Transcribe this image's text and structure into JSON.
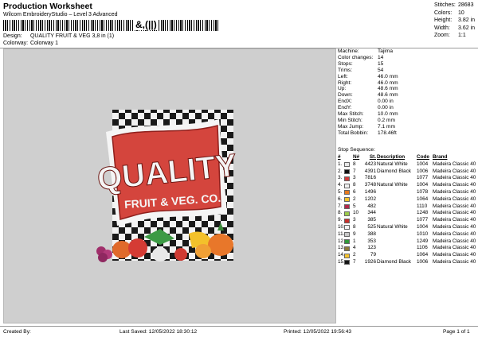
{
  "header": {
    "title": "Production Worksheet",
    "subtitle": "Wilcom EmbroideryStudio – Level 3 Advanced",
    "barcode_text": "&,(||)",
    "design_label": "Design:",
    "design_value": "QUALITY FRUIT & VEG 3,8 in (1)",
    "colorway_label": "Colorway:",
    "colorway_value": "Colorway 1"
  },
  "stats": [
    {
      "key": "Stitches:",
      "value": "28683"
    },
    {
      "key": "Colors:",
      "value": "10"
    },
    {
      "key": "Height:",
      "value": "3.82 in"
    },
    {
      "key": "Width:",
      "value": "3.62 in"
    },
    {
      "key": "Zoom:",
      "value": "1:1"
    }
  ],
  "design_preview": {
    "headline": "QUALITY",
    "tagline": "FRUIT & VEG. CO."
  },
  "info": [
    {
      "key": "Machine:",
      "value": "Tajima"
    },
    {
      "key": "Color changes:",
      "value": "14"
    },
    {
      "key": "Stops:",
      "value": "15"
    },
    {
      "key": "Trims:",
      "value": "54"
    },
    {
      "key": "Left:",
      "value": "46.0 mm"
    },
    {
      "key": "Right:",
      "value": "46.0 mm"
    },
    {
      "key": "Up:",
      "value": "48.6 mm"
    },
    {
      "key": "Down:",
      "value": "48.6 mm"
    },
    {
      "key": "EndX:",
      "value": "0.00 in"
    },
    {
      "key": "EndY:",
      "value": "0.00 in"
    },
    {
      "key": "Max Stitch:",
      "value": "10.0 mm"
    },
    {
      "key": "Min Stitch:",
      "value": "0.2 mm"
    },
    {
      "key": "Max Jump:",
      "value": "7.1 mm"
    },
    {
      "key": "Total Bobbin:",
      "value": "178.46ft"
    }
  ],
  "sequence": {
    "title": "Stop Sequence:",
    "headers": {
      "num": "#",
      "stop": "N#",
      "st": "St.",
      "desc": "Description",
      "code": "Code",
      "brand": "Brand"
    },
    "rows": [
      {
        "n": "1.",
        "color": "#e8e8e8",
        "stop": "8",
        "st": "4423",
        "desc": "Natural White",
        "code": "1004",
        "brand": "Madeira Classic 40"
      },
      {
        "n": "2.",
        "color": "#111111",
        "stop": "7",
        "st": "4391",
        "desc": "Diamond Black",
        "code": "1006",
        "brand": "Madeira Classic 40"
      },
      {
        "n": "3.",
        "color": "#d23b3b",
        "stop": "3",
        "st": "7816",
        "desc": "",
        "code": "1077",
        "brand": "Madeira Classic 40"
      },
      {
        "n": "4.",
        "color": "#f0f0f0",
        "stop": "8",
        "st": "3748",
        "desc": "Natural White",
        "code": "1004",
        "brand": "Madeira Classic 40"
      },
      {
        "n": "5.",
        "color": "#e87a1d",
        "stop": "6",
        "st": "1496",
        "desc": "",
        "code": "1078",
        "brand": "Madeira Classic 40"
      },
      {
        "n": "6.",
        "color": "#f4c22a",
        "stop": "2",
        "st": "1202",
        "desc": "",
        "code": "1064",
        "brand": "Madeira Classic 40"
      },
      {
        "n": "7.",
        "color": "#b3264a",
        "stop": "5",
        "st": "482",
        "desc": "",
        "code": "1110",
        "brand": "Madeira Classic 40"
      },
      {
        "n": "8.",
        "color": "#9ccc4a",
        "stop": "10",
        "st": "344",
        "desc": "",
        "code": "1248",
        "brand": "Madeira Classic 40"
      },
      {
        "n": "9.",
        "color": "#c9302c",
        "stop": "3",
        "st": "385",
        "desc": "",
        "code": "1077",
        "brand": "Madeira Classic 40"
      },
      {
        "n": "10.",
        "color": "#f2f2f2",
        "stop": "8",
        "st": "525",
        "desc": "Natural White",
        "code": "1004",
        "brand": "Madeira Classic 40"
      },
      {
        "n": "11.",
        "color": "#c8c8c8",
        "stop": "9",
        "st": "388",
        "desc": "",
        "code": "1010",
        "brand": "Madeira Classic 40"
      },
      {
        "n": "12.",
        "color": "#2f9a3a",
        "stop": "1",
        "st": "353",
        "desc": "",
        "code": "1249",
        "brand": "Madeira Classic 40"
      },
      {
        "n": "13.",
        "color": "#8c7a3a",
        "stop": "4",
        "st": "123",
        "desc": "",
        "code": "1106",
        "brand": "Madeira Classic 40"
      },
      {
        "n": "14.",
        "color": "#f6c431",
        "stop": "2",
        "st": "79",
        "desc": "",
        "code": "1064",
        "brand": "Madeira Classic 40"
      },
      {
        "n": "15.",
        "color": "#141414",
        "stop": "7",
        "st": "1926",
        "desc": "Diamond Black",
        "code": "1006",
        "brand": "Madeira Classic 40"
      }
    ]
  },
  "footer": {
    "created_by": "Created By:",
    "last_saved": "Last Saved: 12/05/2022 18:30:12",
    "printed": "Printed: 12/05/2022 19:56:43",
    "page": "Page 1 of 1"
  }
}
